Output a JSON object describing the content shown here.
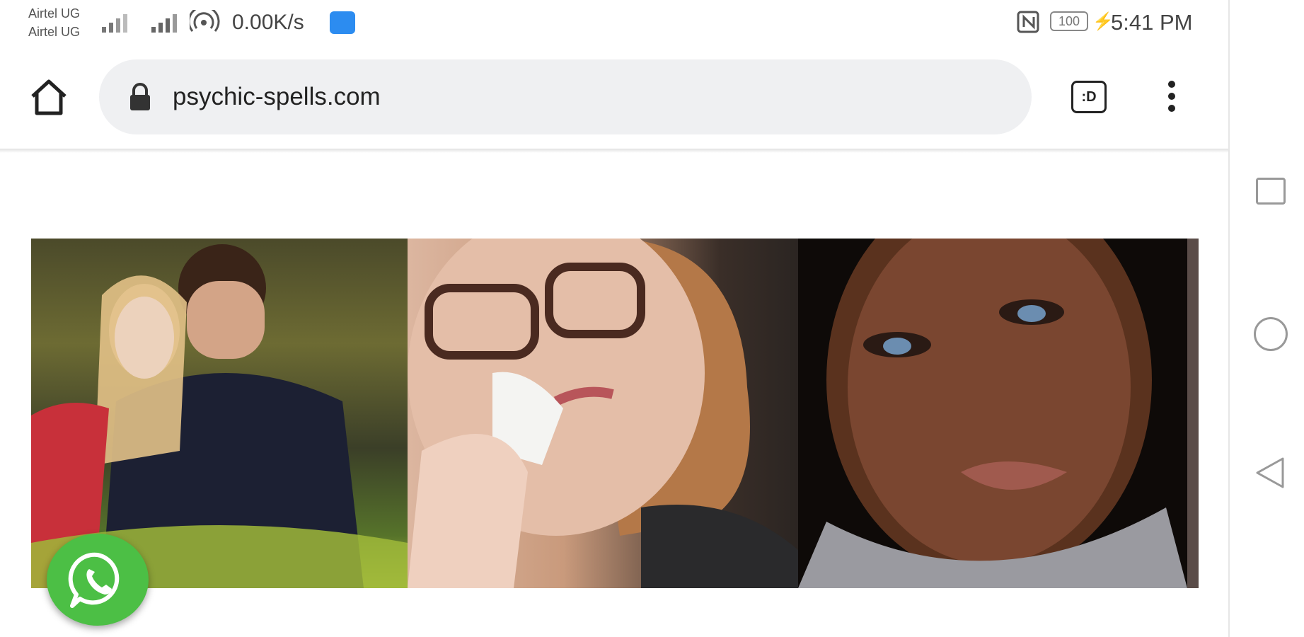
{
  "status_bar": {
    "carrier_1": "Airtel UG",
    "carrier_2": "Airtel UG",
    "net_speed": "0.00K/s",
    "battery": "100",
    "time": "5:41 PM"
  },
  "browser": {
    "url": "psychic-spells.com",
    "tab_switcher_label": ":D"
  },
  "colors": {
    "whatsapp_green": "#4cbf45",
    "omnibox_bg": "#eff0f2"
  },
  "icons": {
    "home": "home-icon",
    "lock": "lock-icon",
    "menu": "more-vert-icon",
    "whatsapp": "whatsapp-icon",
    "nav_recent": "square-icon",
    "nav_home": "circle-icon",
    "nav_back": "triangle-back-icon"
  }
}
